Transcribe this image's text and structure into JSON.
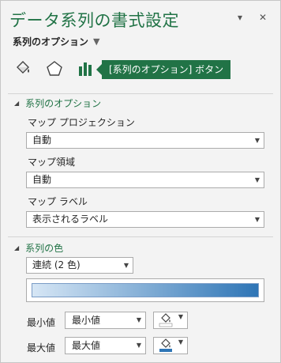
{
  "pane": {
    "title": "データ系列の書式設定",
    "subtitle": "系列のオプション",
    "pin_glyph": "▾",
    "close_glyph": "✕"
  },
  "icons": [
    "fill-bucket-icon",
    "pentagon-icon",
    "bar-chart-icon"
  ],
  "tooltip": "[系列のオプション] ボタン",
  "series_options": {
    "header": "系列のオプション",
    "map_projection_label": "マップ プロジェクション",
    "map_projection_value": "自動",
    "map_area_label": "マップ領域",
    "map_area_value": "自動",
    "map_labels_label": "マップ ラベル",
    "map_labels_value": "表示されるラベル"
  },
  "series_color": {
    "header": "系列の色",
    "scheme_value": "連続 (2 色)",
    "gradient_colors": [
      "#d6e6f5",
      "#2e75b6"
    ],
    "min_label": "最小値",
    "min_value": "最小値",
    "max_label": "最大値",
    "max_value": "最大値",
    "accent": "#217346",
    "min_color": "#ffffff",
    "max_color": "#2e75b6"
  }
}
